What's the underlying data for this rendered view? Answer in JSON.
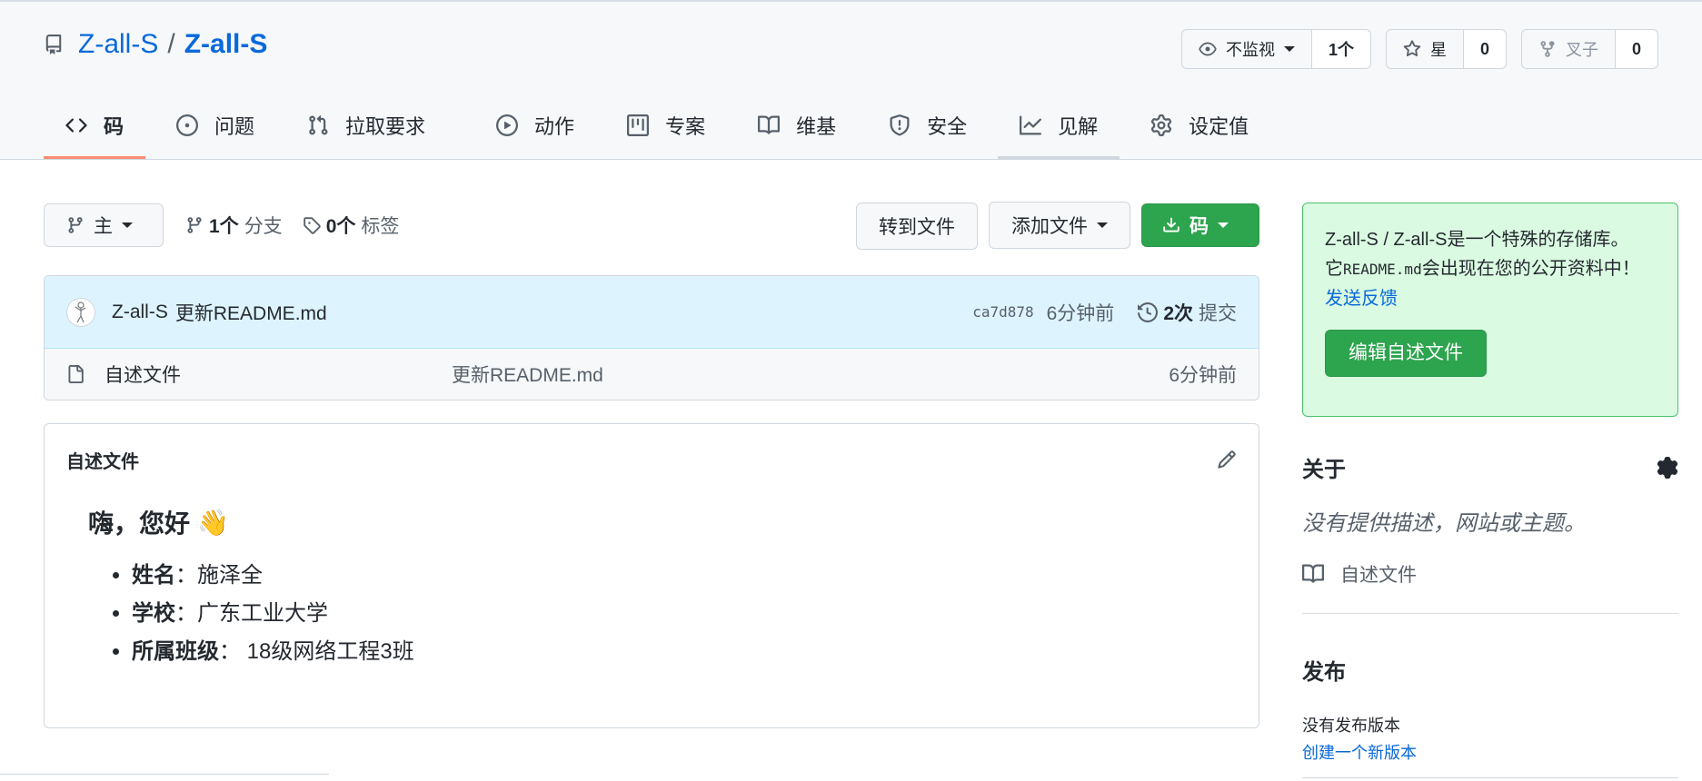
{
  "repo": {
    "owner": "Z-all-S",
    "separator": "/",
    "name": "Z-all-S"
  },
  "actions": {
    "watch": {
      "label": "不监视",
      "count": "1个"
    },
    "star": {
      "label": "星",
      "count": "0"
    },
    "fork": {
      "label": "叉子",
      "count": "0"
    }
  },
  "tabs": [
    {
      "label": "码",
      "icon": "code-icon"
    },
    {
      "label": "问题",
      "icon": "issue-icon"
    },
    {
      "label": "拉取要求",
      "icon": "pull-request-icon"
    },
    {
      "label": "动作",
      "icon": "play-icon"
    },
    {
      "label": "专案",
      "icon": "project-icon"
    },
    {
      "label": "维基",
      "icon": "book-icon"
    },
    {
      "label": "安全",
      "icon": "shield-icon"
    },
    {
      "label": "见解",
      "icon": "graph-icon"
    },
    {
      "label": "设定值",
      "icon": "gear-icon"
    }
  ],
  "toolbar": {
    "branch": "主",
    "branches_count": "1个",
    "branches_label": "分支",
    "tags_count": "0个",
    "tags_label": "标签",
    "goto_file": "转到文件",
    "add_file": "添加文件",
    "code": "码"
  },
  "commit": {
    "author": "Z-all-S",
    "message": "更新README.md",
    "sha": "ca7d878",
    "ago": "6分钟前",
    "history_count": "2次",
    "history_label": "提交"
  },
  "files": [
    {
      "name": "自述文件",
      "message": "更新README.md",
      "ago": "6分钟前"
    }
  ],
  "readme": {
    "title": "自述文件",
    "heading": "嗨，您好",
    "emoji": "👋",
    "items": [
      {
        "key": "姓名",
        "value": "：施泽全"
      },
      {
        "key": "学校",
        "value": "：广东工业大学"
      },
      {
        "key": "所属班级",
        "value": "： 18级网络工程3班"
      }
    ]
  },
  "sidebar": {
    "flash_text_1": "Z-all-S / Z-all-S是一个特殊的存储库。",
    "flash_text_2a": "它",
    "flash_code": "README.md",
    "flash_text_2b": "会出现在您的公开资料中！",
    "feedback": "发送反馈",
    "edit_button": "编辑自述文件",
    "about_title": "关于",
    "about_desc": "没有提供描述，网站或主题。",
    "readme_link": "自述文件",
    "releases_title": "发布",
    "releases_none": "没有发布版本",
    "releases_create": "创建一个新版本"
  },
  "colors": {
    "accent": "#0969da",
    "green": "#2da44e",
    "tab_underline": "#fd8c73",
    "flash_bg": "#dafbe1"
  }
}
